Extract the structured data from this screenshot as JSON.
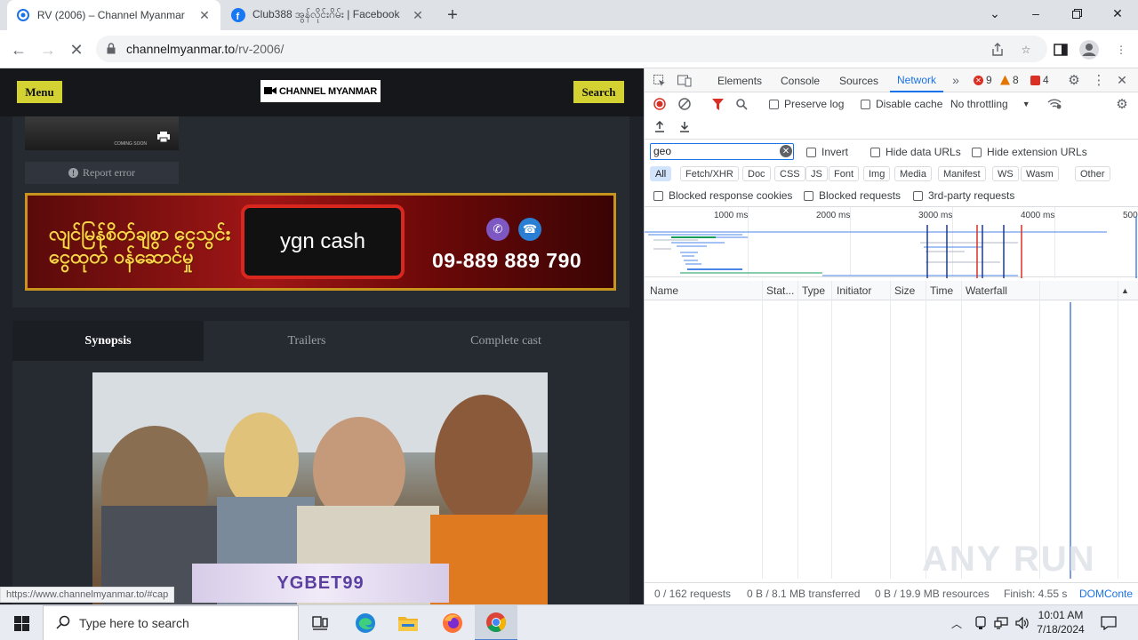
{
  "browser": {
    "tabs": [
      {
        "title": "RV (2006) – Channel Myanmar",
        "active": true,
        "favicon": "channel-myanmar-icon"
      },
      {
        "title": "Club388 အွန်လိုင်းဂိမ်း | Facebook",
        "active": false,
        "favicon": "facebook-icon"
      }
    ],
    "address": {
      "host": "channelmyanmar.to",
      "path": "/rv-2006/"
    },
    "status_url": "https://www.channelmyanmar.to/#cap"
  },
  "page": {
    "menu_label": "Menu",
    "search_label": "Search",
    "logo_text": "CHANNEL MYANMAR",
    "thumb_caption": "COMING SOON",
    "report_error": "Report error",
    "banner": {
      "left_text": "လျင်မြန်စိတ်ချစွာ ငွေသွင်းငွေထုတ် ဝန်ဆောင်မှု",
      "brand": "ygn cash",
      "phone": "09-889 889 790"
    },
    "tabs": [
      "Synopsis",
      "Trailers",
      "Complete cast"
    ],
    "ad_text": "YGBET99"
  },
  "devtools": {
    "tabs": [
      "Elements",
      "Console",
      "Sources",
      "Network"
    ],
    "active_tab": "Network",
    "errors": "9",
    "warnings": "8",
    "issues": "4",
    "preserve_log": "Preserve log",
    "disable_cache": "Disable cache",
    "throttling": "No throttling",
    "filter_value": "geo",
    "invert": "Invert",
    "hide_data_urls": "Hide data URLs",
    "hide_extension_urls": "Hide extension URLs",
    "type_filters": [
      "All",
      "Fetch/XHR",
      "Doc",
      "CSS",
      "JS",
      "Font",
      "Img",
      "Media",
      "Manifest",
      "WS",
      "Wasm",
      "Other"
    ],
    "blocked_response_cookies": "Blocked response cookies",
    "blocked_requests": "Blocked requests",
    "third_party": "3rd-party requests",
    "timeline_ticks": [
      "1000 ms",
      "2000 ms",
      "3000 ms",
      "4000 ms",
      "500"
    ],
    "columns": [
      "Name",
      "Stat...",
      "Type",
      "Initiator",
      "Size",
      "Time",
      "Waterfall"
    ],
    "status": {
      "requests": "0 / 162 requests",
      "transferred": "0 B / 8.1 MB transferred",
      "resources": "0 B / 19.9 MB resources",
      "finish": "Finish: 4.55 s",
      "domcontent": "DOMConte"
    },
    "watermark": "ANY RUN"
  },
  "taskbar": {
    "search_placeholder": "Type here to search",
    "time": "10:01 AM",
    "date": "7/18/2024"
  },
  "colors": {
    "accent": "#1a73e8",
    "site_yellow": "#d4d233",
    "site_bg": "#1f2228"
  }
}
